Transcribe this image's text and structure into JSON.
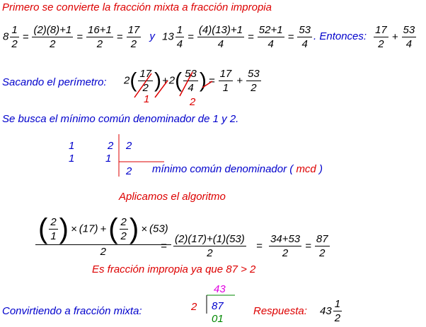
{
  "line1_text": "Primero se convierte la fracción mixta a fracción impropia",
  "conv": {
    "a_whole": "8",
    "a_n": "1",
    "a_d": "2",
    "a_n2": "(2)(8)+1",
    "a_d2": "2",
    "a_n3": "16+1",
    "a_d3": "2",
    "a_n4": "17",
    "a_d4": "2",
    "y": "y",
    "b_whole": "13",
    "b_n": "1",
    "b_d": "4",
    "b_n2": "(4)(13)+1",
    "b_d2": "4",
    "b_n3": "52+1",
    "b_d3": "4",
    "b_n4": "53",
    "b_d4": "4",
    "entonces": ". Entonces:",
    "s_n1": "17",
    "s_d1": "2",
    "s_n2": "53",
    "s_d2": "4"
  },
  "perimetro": {
    "label": "Sacando el perímetro:",
    "c1": "2",
    "n1": "17",
    "d1": "2",
    "c2": "2",
    "n2": "53",
    "d2": "4",
    "cancel1": "1",
    "cancel2": "2",
    "r_n1": "17",
    "r_d1": "1",
    "r_n2": "53",
    "r_d2": "2"
  },
  "mcd_text": "Se busca el mínimo común denominador de 1 y 2.",
  "table": {
    "r1c1": "1",
    "r1c2": "2",
    "r1c3": "2",
    "r2c1": "1",
    "r2c2": "1",
    "r3c3": "2",
    "caption": "mínimo común denominador ( ",
    "mcd": "mcd",
    "caption_end": " )"
  },
  "algoritmo": "Aplicamos el algoritmo",
  "alg": {
    "f1n": "2",
    "f1d": "1",
    "times": "×",
    "p17": "(17)",
    "plus": "+",
    "f2n": "2",
    "f2d": "2",
    "p53": "(53)",
    "den": "2",
    "eq1": "=",
    "e2n": "(2)(17)+(1)(53)",
    "e2d": "2",
    "eq2": "=",
    "e3n": "34+53",
    "e3d": "2",
    "e4n": "87",
    "e4d": "2"
  },
  "impropia": "Es fracción impropia ya que 87 > 2",
  "mixta": {
    "label": "Convirtiendo a fracción mixta:",
    "divisor": "2",
    "quotient": "43",
    "dividend": "87",
    "remainder": "01",
    "resp_label": "Respuesta:",
    "resp_whole": "43",
    "resp_n": "1",
    "resp_d": "2"
  },
  "colors": {
    "red": "#dd0000",
    "blue": "#0000cc",
    "magenta": "#e000e0",
    "green": "#008800"
  }
}
